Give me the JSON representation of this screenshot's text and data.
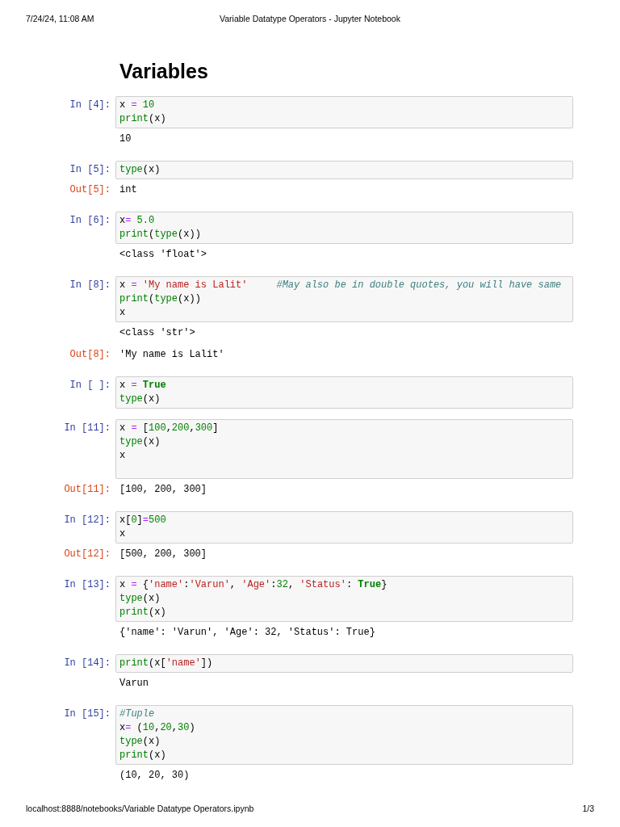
{
  "print_header": {
    "date": "7/24/24, 11:08 AM",
    "title": "Variable Datatype Operators - Jupyter Notebook"
  },
  "heading": "Variables",
  "cells": [
    {
      "prompt": "In [4]:",
      "code": [
        [
          {
            "kind": "plain",
            "text": "x "
          },
          {
            "kind": "op",
            "text": "="
          },
          {
            "kind": "num",
            "text": " 10"
          }
        ],
        [
          {
            "kind": "builtin",
            "text": "print"
          },
          {
            "kind": "plain",
            "text": "(x)"
          }
        ]
      ],
      "outputs": [
        {
          "kind": "stream",
          "text": "10"
        }
      ]
    },
    {
      "prompt": "In [5]:",
      "code": [
        [
          {
            "kind": "builtin",
            "text": "type"
          },
          {
            "kind": "plain",
            "text": "(x)"
          }
        ]
      ],
      "outputs": [
        {
          "kind": "result",
          "prompt": "Out[5]:",
          "text": "int"
        }
      ]
    },
    {
      "prompt": "In [6]:",
      "code": [
        [
          {
            "kind": "plain",
            "text": "x"
          },
          {
            "kind": "op",
            "text": "="
          },
          {
            "kind": "num",
            "text": " 5.0"
          }
        ],
        [
          {
            "kind": "builtin",
            "text": "print"
          },
          {
            "kind": "plain",
            "text": "("
          },
          {
            "kind": "builtin",
            "text": "type"
          },
          {
            "kind": "plain",
            "text": "(x))"
          }
        ]
      ],
      "outputs": [
        {
          "kind": "stream",
          "text": "<class 'float'>"
        }
      ]
    },
    {
      "prompt": "In [8]:",
      "code": [
        [
          {
            "kind": "plain",
            "text": "x "
          },
          {
            "kind": "op",
            "text": "="
          },
          {
            "kind": "str",
            "text": " 'My name is Lalit'"
          },
          {
            "kind": "comment",
            "text": "     #May also be in double quotes, you will have same"
          }
        ],
        [
          {
            "kind": "builtin",
            "text": "print"
          },
          {
            "kind": "plain",
            "text": "("
          },
          {
            "kind": "builtin",
            "text": "type"
          },
          {
            "kind": "plain",
            "text": "(x))"
          }
        ],
        [
          {
            "kind": "plain",
            "text": "x"
          }
        ]
      ],
      "outputs": [
        {
          "kind": "stream",
          "text": "<class 'str'>"
        },
        {
          "kind": "result",
          "prompt": "Out[8]:",
          "text": "'My name is Lalit'"
        }
      ]
    },
    {
      "prompt": "In [ ]:",
      "code": [
        [
          {
            "kind": "plain",
            "text": "x "
          },
          {
            "kind": "op",
            "text": "="
          },
          {
            "kind": "keyword",
            "text": " True"
          }
        ],
        [
          {
            "kind": "builtin",
            "text": "type"
          },
          {
            "kind": "plain",
            "text": "(x)"
          }
        ]
      ]
    },
    {
      "prompt": "In [11]:",
      "trailing_blank_line": true,
      "code": [
        [
          {
            "kind": "plain",
            "text": "x "
          },
          {
            "kind": "op",
            "text": "="
          },
          {
            "kind": "plain",
            "text": " ["
          },
          {
            "kind": "num",
            "text": "100"
          },
          {
            "kind": "plain",
            "text": ","
          },
          {
            "kind": "num",
            "text": "200"
          },
          {
            "kind": "plain",
            "text": ","
          },
          {
            "kind": "num",
            "text": "300"
          },
          {
            "kind": "plain",
            "text": "]"
          }
        ],
        [
          {
            "kind": "builtin",
            "text": "type"
          },
          {
            "kind": "plain",
            "text": "(x)"
          }
        ],
        [
          {
            "kind": "plain",
            "text": "x"
          }
        ]
      ],
      "outputs": [
        {
          "kind": "result",
          "prompt": "Out[11]:",
          "text": "[100, 200, 300]"
        }
      ]
    },
    {
      "prompt": "In [12]:",
      "code": [
        [
          {
            "kind": "plain",
            "text": "x["
          },
          {
            "kind": "num",
            "text": "0"
          },
          {
            "kind": "plain",
            "text": "]"
          },
          {
            "kind": "op",
            "text": "="
          },
          {
            "kind": "num",
            "text": "500"
          }
        ],
        [
          {
            "kind": "plain",
            "text": "x"
          }
        ]
      ],
      "outputs": [
        {
          "kind": "result",
          "prompt": "Out[12]:",
          "text": "[500, 200, 300]"
        }
      ]
    },
    {
      "prompt": "In [13]:",
      "code": [
        [
          {
            "kind": "plain",
            "text": "x "
          },
          {
            "kind": "op",
            "text": "="
          },
          {
            "kind": "plain",
            "text": " {"
          },
          {
            "kind": "str",
            "text": "'name'"
          },
          {
            "kind": "plain",
            "text": ":"
          },
          {
            "kind": "str",
            "text": "'Varun'"
          },
          {
            "kind": "plain",
            "text": ", "
          },
          {
            "kind": "str",
            "text": "'Age'"
          },
          {
            "kind": "plain",
            "text": ":"
          },
          {
            "kind": "num",
            "text": "32"
          },
          {
            "kind": "plain",
            "text": ", "
          },
          {
            "kind": "str",
            "text": "'Status'"
          },
          {
            "kind": "plain",
            "text": ": "
          },
          {
            "kind": "keyword",
            "text": "True"
          },
          {
            "kind": "plain",
            "text": "}"
          }
        ],
        [
          {
            "kind": "builtin",
            "text": "type"
          },
          {
            "kind": "plain",
            "text": "(x)"
          }
        ],
        [
          {
            "kind": "builtin",
            "text": "print"
          },
          {
            "kind": "plain",
            "text": "(x)"
          }
        ]
      ],
      "outputs": [
        {
          "kind": "stream",
          "text": "{'name': 'Varun', 'Age': 32, 'Status': True}"
        }
      ]
    },
    {
      "prompt": "In [14]:",
      "code": [
        [
          {
            "kind": "builtin",
            "text": "print"
          },
          {
            "kind": "plain",
            "text": "(x["
          },
          {
            "kind": "str",
            "text": "'name'"
          },
          {
            "kind": "plain",
            "text": "])"
          }
        ]
      ],
      "outputs": [
        {
          "kind": "stream",
          "text": "Varun"
        }
      ]
    },
    {
      "prompt": "In [15]:",
      "code": [
        [
          {
            "kind": "comment",
            "text": "#Tuple"
          }
        ],
        [
          {
            "kind": "plain",
            "text": "x"
          },
          {
            "kind": "op",
            "text": "="
          },
          {
            "kind": "plain",
            "text": " ("
          },
          {
            "kind": "num",
            "text": "10"
          },
          {
            "kind": "plain",
            "text": ","
          },
          {
            "kind": "num",
            "text": "20"
          },
          {
            "kind": "plain",
            "text": ","
          },
          {
            "kind": "num",
            "text": "30"
          },
          {
            "kind": "plain",
            "text": ")"
          }
        ],
        [
          {
            "kind": "builtin",
            "text": "type"
          },
          {
            "kind": "plain",
            "text": "(x)"
          }
        ],
        [
          {
            "kind": "builtin",
            "text": "print"
          },
          {
            "kind": "plain",
            "text": "(x)"
          }
        ]
      ],
      "outputs": [
        {
          "kind": "stream",
          "text": "(10, 20, 30)"
        }
      ]
    }
  ],
  "print_footer": {
    "url": "localhost:8888/notebooks/Variable Datatype Operators.ipynb",
    "page": "1/3"
  }
}
